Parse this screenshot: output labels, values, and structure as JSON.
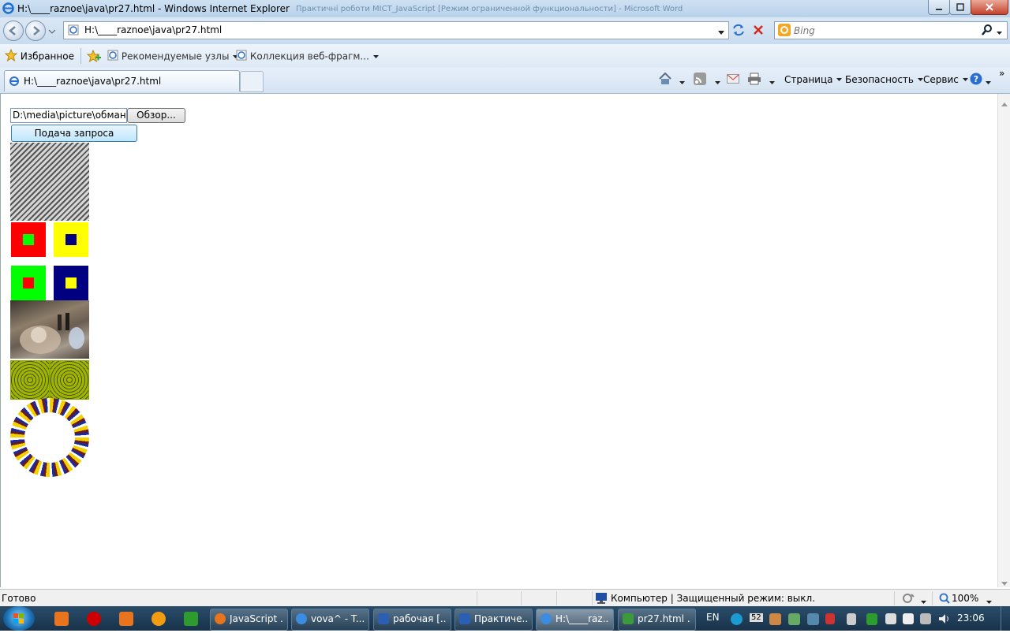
{
  "window": {
    "title": "H:\\____raznoe\\java\\pr27.html - Windows Internet Explorer",
    "background_title": "Практичні роботи МІСТ_JavaScript [Режим ограниченной функциональности] - Microsoft Word"
  },
  "address_bar": {
    "url": "H:\\____raznoe\\java\\pr27.html"
  },
  "search": {
    "placeholder": "Bing"
  },
  "favorites_bar": {
    "favorites_label": "Избранное",
    "items": [
      "Рекомендуемые узлы",
      "Коллекция веб-фрагм..."
    ]
  },
  "tab": {
    "title": "H:\\____raznoe\\java\\pr27.html"
  },
  "command_bar": {
    "page": "Страница",
    "safety": "Безопасность",
    "tools": "Сервис",
    "more": "»"
  },
  "page": {
    "file_input_value": "D:\\media\\picture\\обман",
    "browse_button": "Обзор...",
    "submit_button": "Подача запроса",
    "color_squares": [
      {
        "outer": "#ff0000",
        "inner": "#00ff00"
      },
      {
        "outer": "#ffff00",
        "inner": "#000080"
      },
      {
        "outer": "#00ff00",
        "inner": "#ff0000"
      },
      {
        "outer": "#000080",
        "inner": "#ffff00"
      }
    ]
  },
  "status_bar": {
    "status": "Готово",
    "zone": "Компьютер | Защищенный режим: выкл.",
    "zoom": "100%"
  },
  "taskbar": {
    "tasks": [
      {
        "label": "JavaScript ...",
        "icon_color": "#e8741e"
      },
      {
        "label": "vova^ - T...",
        "icon_color": "#3a8de0"
      },
      {
        "label": "рабочая [...",
        "icon_color": "#2b5fb4"
      },
      {
        "label": "Практиче...",
        "icon_color": "#2b5fb4"
      },
      {
        "label": "H:\\____raz...",
        "icon_color": "#3a8de0"
      },
      {
        "label": "pr27.html ...",
        "icon_color": "#3b9b3b"
      }
    ],
    "language": "EN",
    "clock": "23:06",
    "tray_badge": "52"
  }
}
